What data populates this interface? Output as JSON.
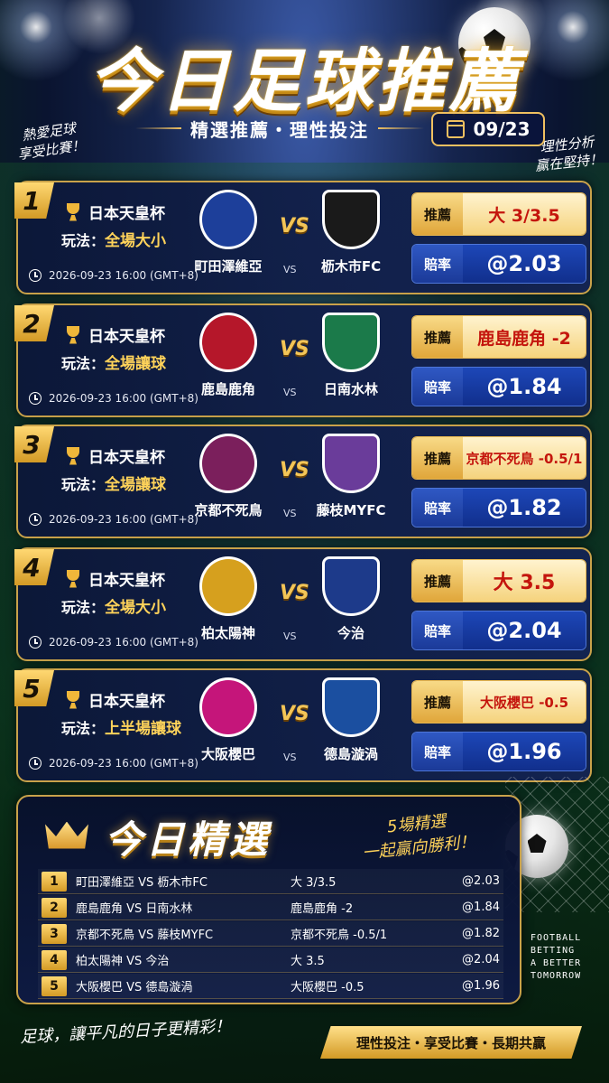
{
  "header": {
    "title": "今日足球推薦",
    "subtitle": "精選推薦・理性投注",
    "date": "09/23",
    "note_left_1": "熱愛足球",
    "note_left_2": "享受比賽！",
    "note_right_1": "理性分析",
    "note_right_2": "贏在堅持！"
  },
  "labels": {
    "rec": "推薦",
    "odds": "賠率",
    "vs_big": "VS",
    "vs_small": "VS"
  },
  "matches": [
    {
      "num": "1",
      "cup": "日本天皇杯",
      "play_label": "玩法：",
      "play": "全場大小",
      "time": "2026-09-23 16:00 (GMT+8)",
      "home": "町田澤維亞",
      "away": "枥木市FC",
      "rec": "大 3/3.5",
      "odds": "@2.03",
      "home_color": "#1d3f9a",
      "away_color": "#1a1a1a"
    },
    {
      "num": "2",
      "cup": "日本天皇杯",
      "play_label": "玩法：",
      "play": "全場讓球",
      "time": "2026-09-23 16:00 (GMT+8)",
      "home": "鹿島鹿角",
      "away": "日南水林",
      "rec": "鹿島鹿角 -2",
      "odds": "@1.84",
      "home_color": "#b5172a",
      "away_color": "#1b7a4a"
    },
    {
      "num": "3",
      "cup": "日本天皇杯",
      "play_label": "玩法：",
      "play": "全場讓球",
      "time": "2026-09-23 16:00 (GMT+8)",
      "home": "京都不死鳥",
      "away": "藤枝MYFC",
      "rec": "京都不死鳥 -0.5/1",
      "odds": "@1.82",
      "home_color": "#7b1f5c",
      "away_color": "#6a3c9a"
    },
    {
      "num": "4",
      "cup": "日本天皇杯",
      "play_label": "玩法：",
      "play": "全場大小",
      "time": "2026-09-23 16:00 (GMT+8)",
      "home": "柏太陽神",
      "away": "今治",
      "rec": "大 3.5",
      "odds": "@2.04",
      "home_color": "#d6a01e",
      "away_color": "#1d3a8a"
    },
    {
      "num": "5",
      "cup": "日本天皇杯",
      "play_label": "玩法：",
      "play": "上半場讓球",
      "time": "2026-09-23 16:00 (GMT+8)",
      "home": "大阪櫻巴",
      "away": "德島漩渦",
      "rec": "大阪櫻巴 -0.5",
      "odds": "@1.96",
      "home_color": "#c5157a",
      "away_color": "#1b4fa0"
    }
  ],
  "summary": {
    "title": "今日精選",
    "slogan_1": "5場精選",
    "slogan_2": "一起贏向勝利！",
    "rows": [
      {
        "n": "1",
        "match": "町田澤維亞 VS 枥木市FC",
        "pick": "大 3/3.5",
        "odds": "@2.03"
      },
      {
        "n": "2",
        "match": "鹿島鹿角 VS 日南水林",
        "pick": "鹿島鹿角 -2",
        "odds": "@1.84"
      },
      {
        "n": "3",
        "match": "京都不死鳥 VS 藤枝MYFC",
        "pick": "京都不死鳥 -0.5/1",
        "odds": "@1.82"
      },
      {
        "n": "4",
        "match": "柏太陽神 VS 今治",
        "pick": "大 3.5",
        "odds": "@2.04"
      },
      {
        "n": "5",
        "match": "大阪櫻巴 VS 德島漩渦",
        "pick": "大阪櫻巴 -0.5",
        "odds": "@1.96"
      }
    ]
  },
  "footer": {
    "tagline_1": "FOOTBALL",
    "tagline_2": "BETTING",
    "tagline_3": "A BETTER",
    "tagline_4": "TOMORROW",
    "left": "足球，讓平凡的日子更精彩！",
    "banner": "理性投注・享受比賽・長期共贏"
  }
}
